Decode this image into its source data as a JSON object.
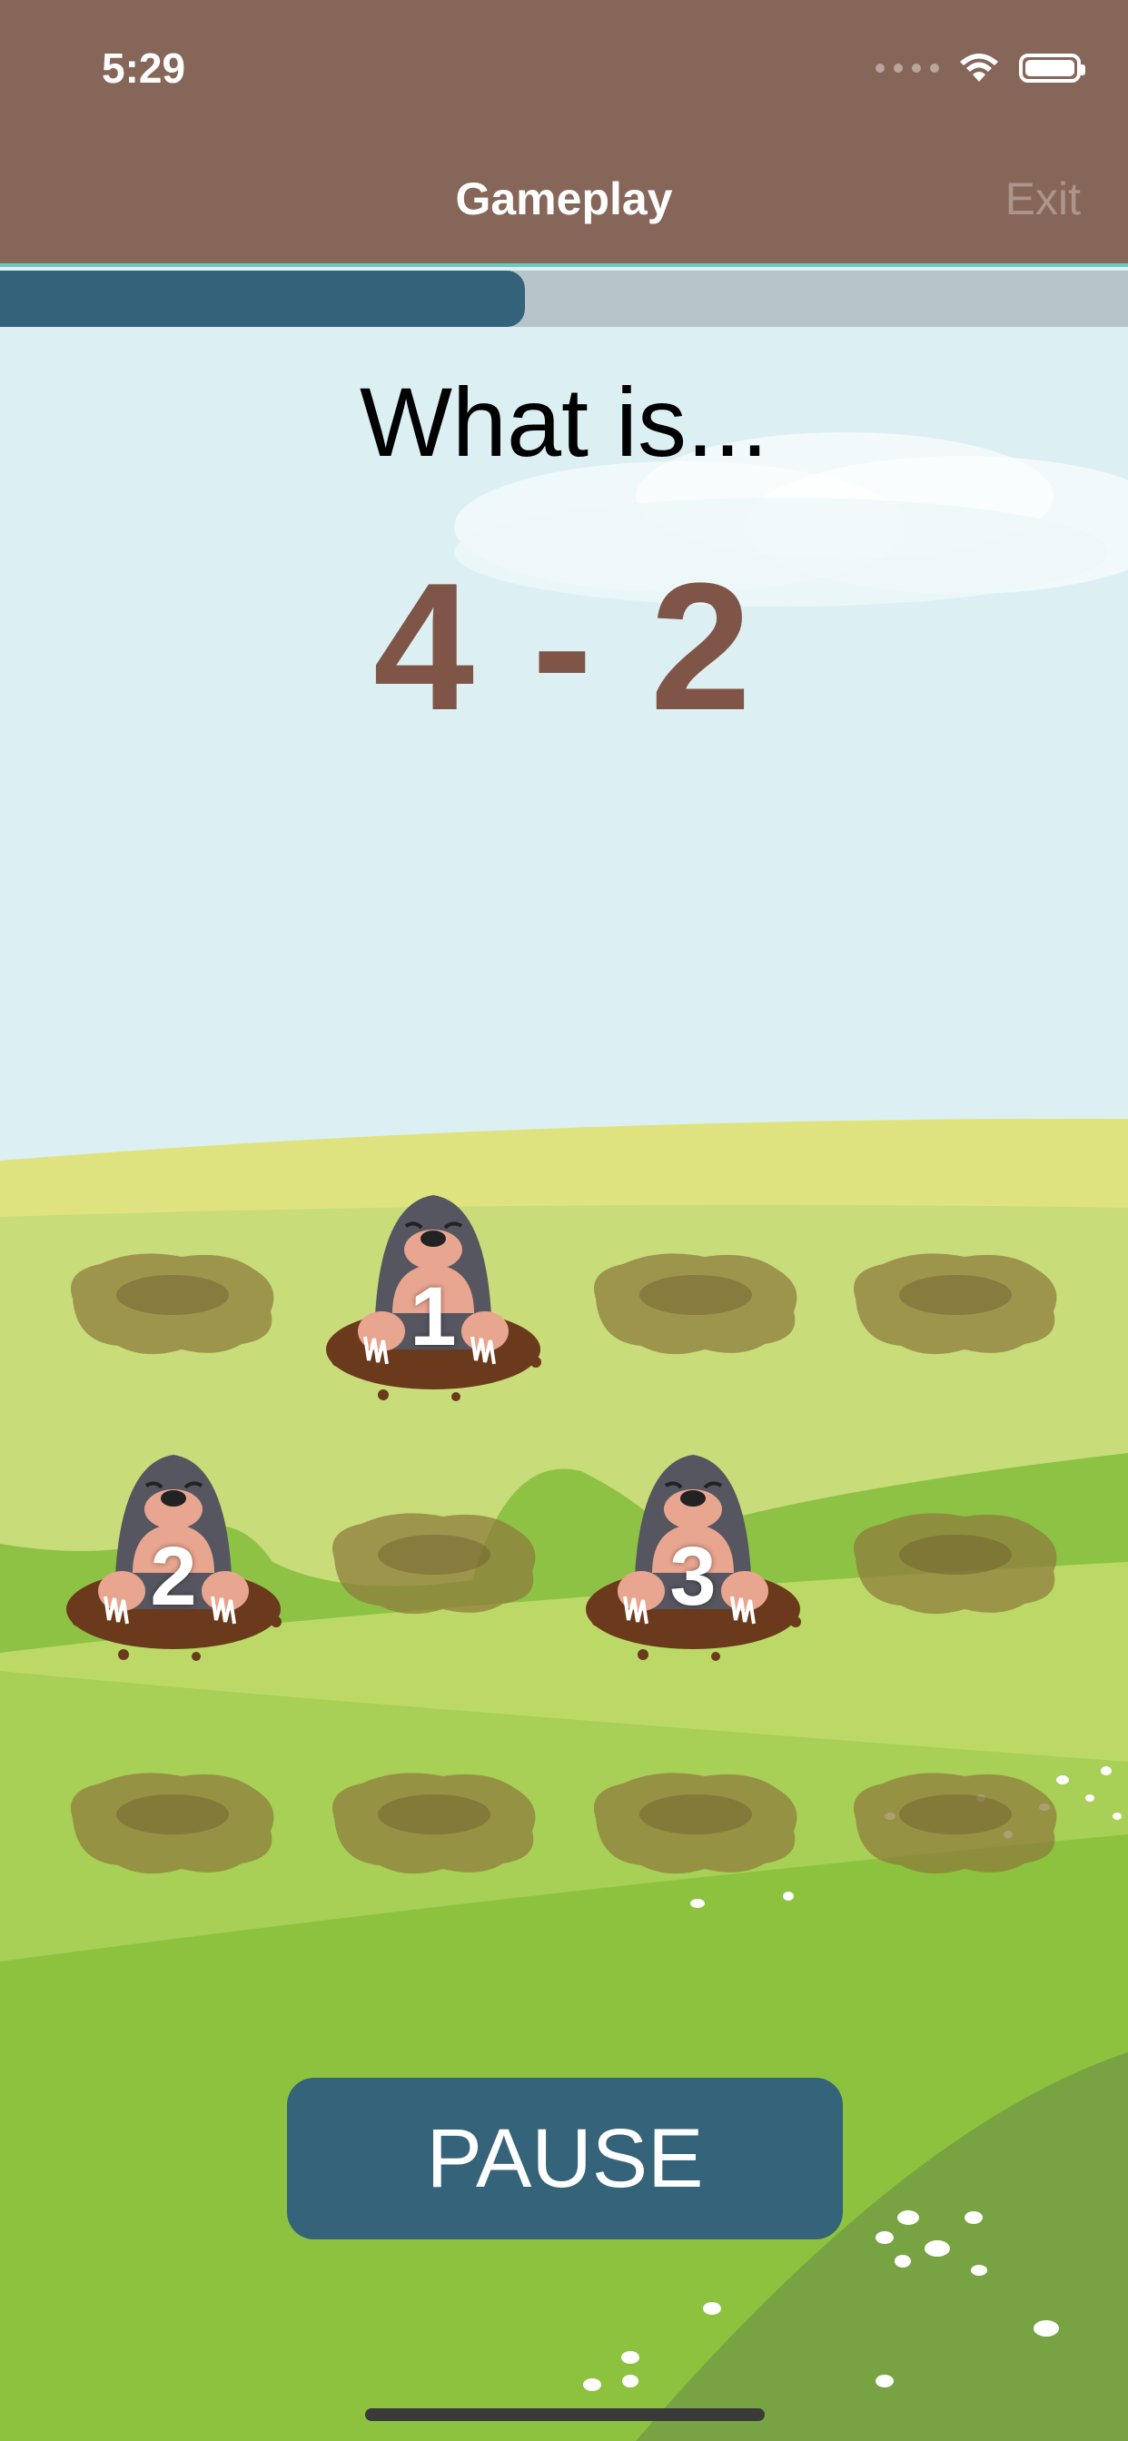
{
  "status_bar": {
    "time": "5:29"
  },
  "nav": {
    "title": "Gameplay",
    "exit_label": "Exit"
  },
  "progress": {
    "fraction": 0.465
  },
  "question": {
    "prompt": "What is...",
    "equation": "4 - 2"
  },
  "moles": [
    {
      "number": "1"
    },
    {
      "number": "2"
    },
    {
      "number": "3"
    }
  ],
  "pause": {
    "label": "PAUSE"
  },
  "colors": {
    "nav": "#87665a",
    "progress_fill": "#33627a",
    "progress_track": "#b7c4ca",
    "equation": "#7e5547",
    "pause_button": "#34637a",
    "sky": "#dcf0f4"
  }
}
